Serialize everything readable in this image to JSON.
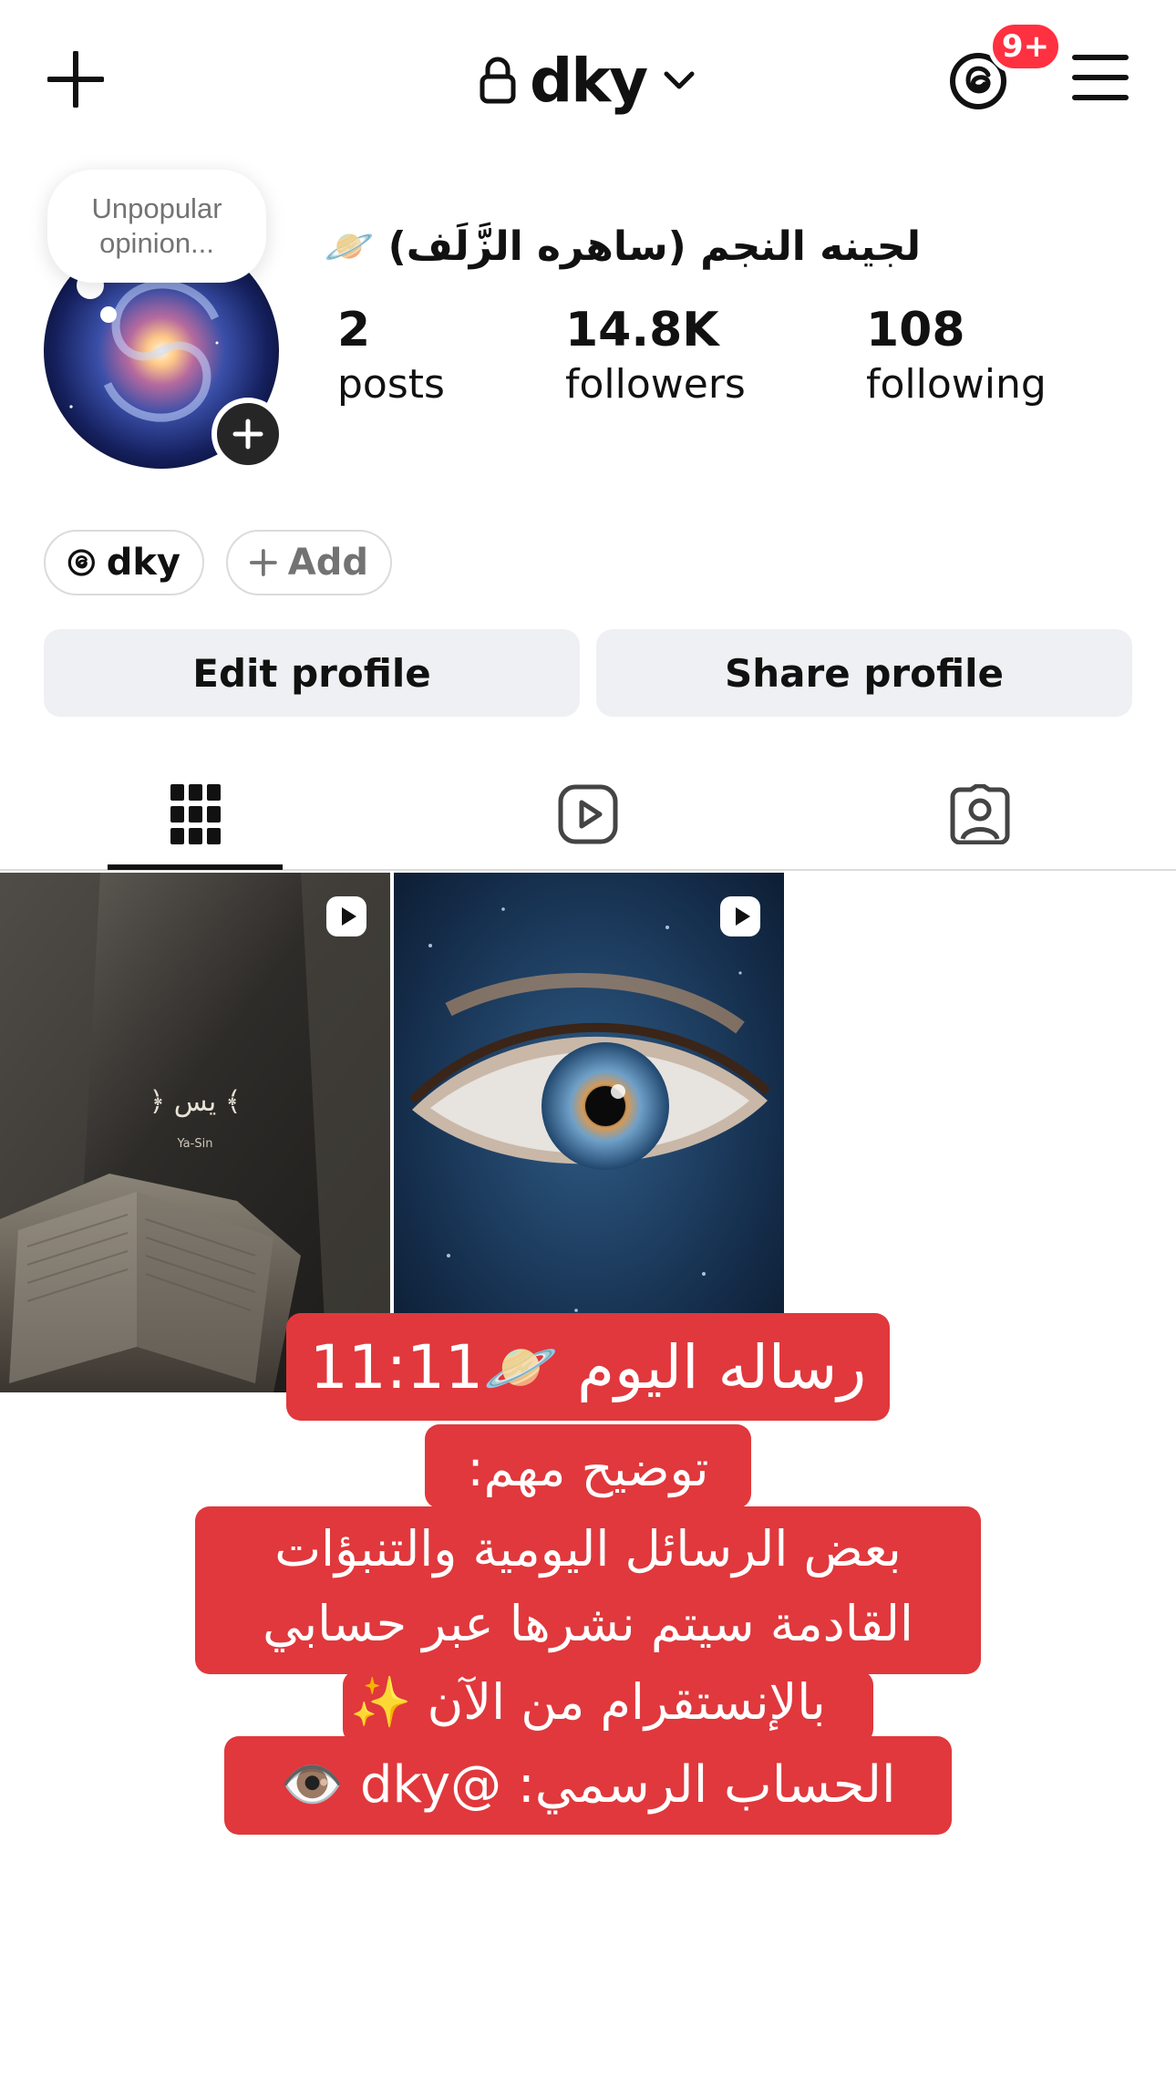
{
  "header": {
    "username": "dky",
    "notification_count": "9+",
    "icons": {
      "new_post": "plus-icon",
      "lock": "lock-icon",
      "switch": "chevron-down-icon",
      "threads": "threads-icon",
      "menu": "hamburger-menu-icon"
    }
  },
  "profile": {
    "note": "Unpopular opinion...",
    "display_name": "لجينه النجم (ساهره الزَّلَف) 🪐",
    "stats": [
      {
        "value": "2",
        "label": "posts"
      },
      {
        "value": "14.8K",
        "label": "followers"
      },
      {
        "value": "108",
        "label": "following"
      }
    ],
    "chips": {
      "threads_label": "dky",
      "add_label": "Add"
    },
    "buttons": {
      "edit": "Edit profile",
      "share": "Share profile"
    }
  },
  "tabs": [
    {
      "name": "grid",
      "icon": "grid-icon",
      "active": true
    },
    {
      "name": "reels",
      "icon": "reels-icon",
      "active": false
    },
    {
      "name": "tagged",
      "icon": "tagged-icon",
      "active": false
    }
  ],
  "posts": [
    {
      "type": "reel",
      "caption": "﴿ يس ﴾",
      "subcaption": "Ya-Sin"
    },
    {
      "type": "reel",
      "caption": "",
      "subcaption": ""
    }
  ],
  "overlay": {
    "line1": "رساله اليوم 🪐11:11",
    "line2": "توضيح مهم:",
    "line3": "بعض الرسائل اليومية والتنبؤات",
    "line4": "القادمة سيتم نشرها عبر حسابي",
    "line5": "بالإنستقرام من الآن ✨",
    "line6": "الحساب الرسمي: @dky 👁️",
    "color": "#e0383c"
  },
  "colors": {
    "badge": "#ff3040",
    "button_bg": "#eff0f3",
    "text": "#111111"
  }
}
